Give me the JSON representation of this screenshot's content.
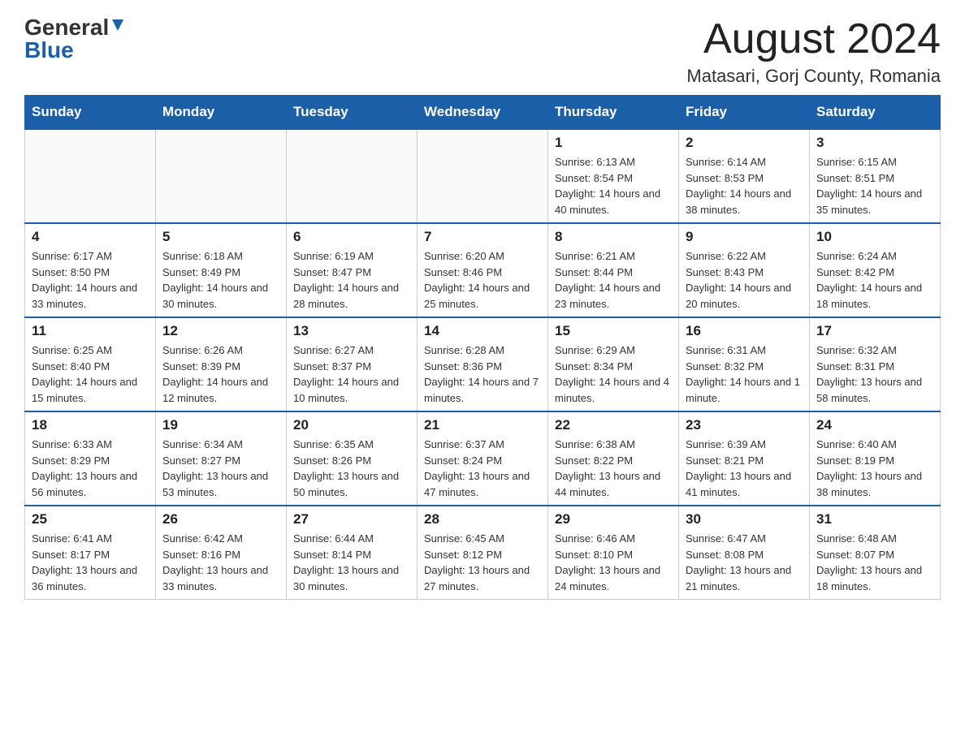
{
  "logo": {
    "general": "General",
    "blue": "Blue",
    "triangle": "▼"
  },
  "header": {
    "title": "August 2024",
    "subtitle": "Matasari, Gorj County, Romania"
  },
  "weekdays": [
    "Sunday",
    "Monday",
    "Tuesday",
    "Wednesday",
    "Thursday",
    "Friday",
    "Saturday"
  ],
  "weeks": [
    [
      {
        "day": "",
        "info": ""
      },
      {
        "day": "",
        "info": ""
      },
      {
        "day": "",
        "info": ""
      },
      {
        "day": "",
        "info": ""
      },
      {
        "day": "1",
        "info": "Sunrise: 6:13 AM\nSunset: 8:54 PM\nDaylight: 14 hours and 40 minutes."
      },
      {
        "day": "2",
        "info": "Sunrise: 6:14 AM\nSunset: 8:53 PM\nDaylight: 14 hours and 38 minutes."
      },
      {
        "day": "3",
        "info": "Sunrise: 6:15 AM\nSunset: 8:51 PM\nDaylight: 14 hours and 35 minutes."
      }
    ],
    [
      {
        "day": "4",
        "info": "Sunrise: 6:17 AM\nSunset: 8:50 PM\nDaylight: 14 hours and 33 minutes."
      },
      {
        "day": "5",
        "info": "Sunrise: 6:18 AM\nSunset: 8:49 PM\nDaylight: 14 hours and 30 minutes."
      },
      {
        "day": "6",
        "info": "Sunrise: 6:19 AM\nSunset: 8:47 PM\nDaylight: 14 hours and 28 minutes."
      },
      {
        "day": "7",
        "info": "Sunrise: 6:20 AM\nSunset: 8:46 PM\nDaylight: 14 hours and 25 minutes."
      },
      {
        "day": "8",
        "info": "Sunrise: 6:21 AM\nSunset: 8:44 PM\nDaylight: 14 hours and 23 minutes."
      },
      {
        "day": "9",
        "info": "Sunrise: 6:22 AM\nSunset: 8:43 PM\nDaylight: 14 hours and 20 minutes."
      },
      {
        "day": "10",
        "info": "Sunrise: 6:24 AM\nSunset: 8:42 PM\nDaylight: 14 hours and 18 minutes."
      }
    ],
    [
      {
        "day": "11",
        "info": "Sunrise: 6:25 AM\nSunset: 8:40 PM\nDaylight: 14 hours and 15 minutes."
      },
      {
        "day": "12",
        "info": "Sunrise: 6:26 AM\nSunset: 8:39 PM\nDaylight: 14 hours and 12 minutes."
      },
      {
        "day": "13",
        "info": "Sunrise: 6:27 AM\nSunset: 8:37 PM\nDaylight: 14 hours and 10 minutes."
      },
      {
        "day": "14",
        "info": "Sunrise: 6:28 AM\nSunset: 8:36 PM\nDaylight: 14 hours and 7 minutes."
      },
      {
        "day": "15",
        "info": "Sunrise: 6:29 AM\nSunset: 8:34 PM\nDaylight: 14 hours and 4 minutes."
      },
      {
        "day": "16",
        "info": "Sunrise: 6:31 AM\nSunset: 8:32 PM\nDaylight: 14 hours and 1 minute."
      },
      {
        "day": "17",
        "info": "Sunrise: 6:32 AM\nSunset: 8:31 PM\nDaylight: 13 hours and 58 minutes."
      }
    ],
    [
      {
        "day": "18",
        "info": "Sunrise: 6:33 AM\nSunset: 8:29 PM\nDaylight: 13 hours and 56 minutes."
      },
      {
        "day": "19",
        "info": "Sunrise: 6:34 AM\nSunset: 8:27 PM\nDaylight: 13 hours and 53 minutes."
      },
      {
        "day": "20",
        "info": "Sunrise: 6:35 AM\nSunset: 8:26 PM\nDaylight: 13 hours and 50 minutes."
      },
      {
        "day": "21",
        "info": "Sunrise: 6:37 AM\nSunset: 8:24 PM\nDaylight: 13 hours and 47 minutes."
      },
      {
        "day": "22",
        "info": "Sunrise: 6:38 AM\nSunset: 8:22 PM\nDaylight: 13 hours and 44 minutes."
      },
      {
        "day": "23",
        "info": "Sunrise: 6:39 AM\nSunset: 8:21 PM\nDaylight: 13 hours and 41 minutes."
      },
      {
        "day": "24",
        "info": "Sunrise: 6:40 AM\nSunset: 8:19 PM\nDaylight: 13 hours and 38 minutes."
      }
    ],
    [
      {
        "day": "25",
        "info": "Sunrise: 6:41 AM\nSunset: 8:17 PM\nDaylight: 13 hours and 36 minutes."
      },
      {
        "day": "26",
        "info": "Sunrise: 6:42 AM\nSunset: 8:16 PM\nDaylight: 13 hours and 33 minutes."
      },
      {
        "day": "27",
        "info": "Sunrise: 6:44 AM\nSunset: 8:14 PM\nDaylight: 13 hours and 30 minutes."
      },
      {
        "day": "28",
        "info": "Sunrise: 6:45 AM\nSunset: 8:12 PM\nDaylight: 13 hours and 27 minutes."
      },
      {
        "day": "29",
        "info": "Sunrise: 6:46 AM\nSunset: 8:10 PM\nDaylight: 13 hours and 24 minutes."
      },
      {
        "day": "30",
        "info": "Sunrise: 6:47 AM\nSunset: 8:08 PM\nDaylight: 13 hours and 21 minutes."
      },
      {
        "day": "31",
        "info": "Sunrise: 6:48 AM\nSunset: 8:07 PM\nDaylight: 13 hours and 18 minutes."
      }
    ]
  ]
}
